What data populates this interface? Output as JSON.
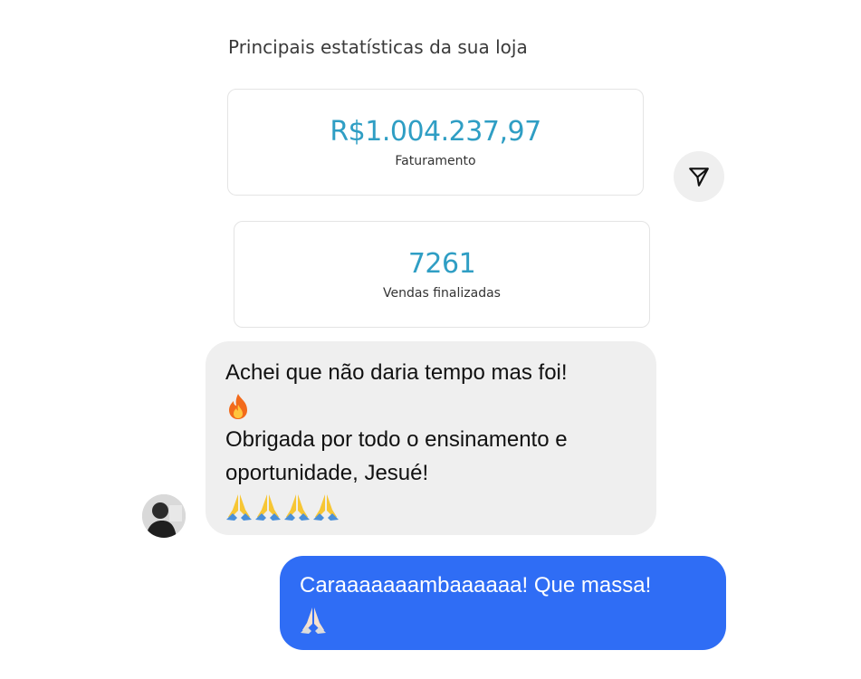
{
  "stats": {
    "heading": "Principais estatísticas da sua loja",
    "cards": [
      {
        "value": "R$1.004.237,97",
        "label": "Faturamento"
      },
      {
        "value": "7261",
        "label": "Vendas finalizadas"
      }
    ]
  },
  "messages": {
    "received": {
      "line1": "Achei que não daria tempo mas foi!",
      "line2": "Obrigada por todo o ensinamento e",
      "line3": "oportunidade, Jesué!",
      "emoji_line1": [
        "fire-emoji"
      ],
      "emoji_line2": [
        "folded-hands-emoji",
        "folded-hands-emoji",
        "folded-hands-emoji",
        "folded-hands-emoji"
      ]
    },
    "sent": {
      "line1": "Caraaaaaaambaaaaaa! Que massa!",
      "emoji_line": [
        "folded-hands-emoji"
      ]
    }
  },
  "colors": {
    "stat_value": "#2f9ec4",
    "received_bubble": "#efefef",
    "sent_bubble": "#2f6df5",
    "share_button_bg": "#efefef"
  },
  "icons": {
    "share": "paper-plane-icon",
    "avatar": "user-avatar"
  }
}
